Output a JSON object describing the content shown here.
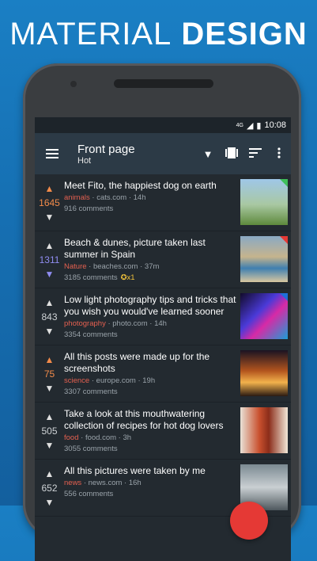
{
  "promo": {
    "headline_light": "MATERIAL",
    "headline_bold": "DESIGN"
  },
  "status": {
    "network": "4G",
    "time": "10:08"
  },
  "appbar": {
    "title": "Front page",
    "subtitle": "Hot"
  },
  "posts": [
    {
      "score": "1645",
      "score_color": "#f28b4a",
      "title": "Meet Fito, the happiest dog on earth",
      "subreddit": "animals",
      "domain": "· cats.com · 14h",
      "comments": "916 comments",
      "gilded": "",
      "tag_color": "#3fbf5a"
    },
    {
      "score": "1311",
      "score_color": "#8f8cf0",
      "title": "Beach & dunes, picture taken last summer in Spain",
      "subreddit": "Nature",
      "domain": "· beaches.com · 37m",
      "comments": "3185 comments",
      "gilded": "x1",
      "tag_color": "#e53935"
    },
    {
      "score": "843",
      "score_color": "#cfd3d6",
      "title": "Low light photography tips and tricks that you wish you would've learned sooner",
      "subreddit": "photography",
      "domain": "· photo.com · 14h",
      "comments": "3354 comments",
      "gilded": "",
      "tag_color": "#1e6fd9"
    },
    {
      "score": "75",
      "score_color": "#f28b4a",
      "title": "All this posts were made up for the screenshots",
      "subreddit": "science",
      "domain": "· europe.com · 19h",
      "comments": "3307 comments",
      "gilded": "",
      "tag_color": ""
    },
    {
      "score": "505",
      "score_color": "#cfd3d6",
      "title": "Take a look at this mouthwatering collection of recipes for hot dog lovers",
      "subreddit": "food",
      "domain": "· food.com · 3h",
      "comments": "3055 comments",
      "gilded": "",
      "tag_color": ""
    },
    {
      "score": "652",
      "score_color": "#cfd3d6",
      "title": "All this pictures were taken by me",
      "subreddit": "news",
      "domain": "· news.com · 16h",
      "comments": "556 comments",
      "gilded": "",
      "tag_color": ""
    }
  ]
}
